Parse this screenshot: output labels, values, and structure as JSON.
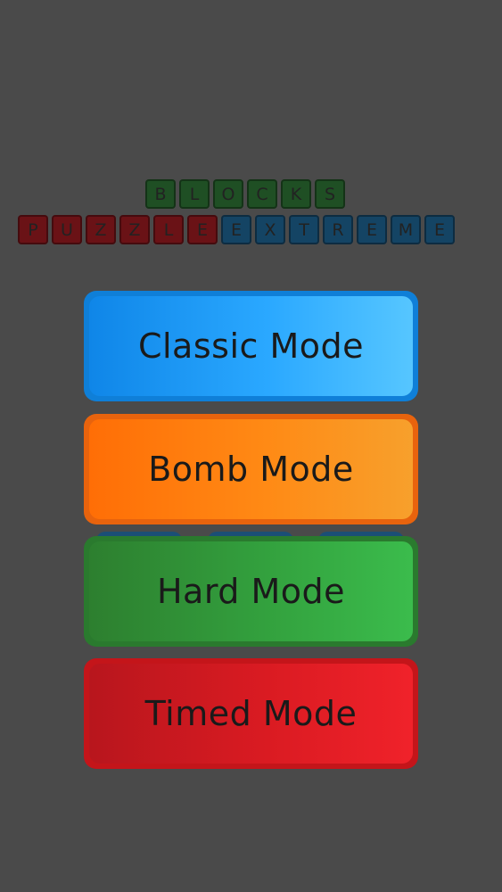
{
  "title": {
    "row1": [
      "B",
      "L",
      "O",
      "C",
      "K",
      "S"
    ],
    "row2_red": [
      "P",
      "U",
      "Z",
      "Z",
      "L",
      "E"
    ],
    "row2_blue": [
      "E",
      "X",
      "T",
      "R",
      "E",
      "M",
      "E"
    ]
  },
  "modes": {
    "classic": "Classic Mode",
    "bomb": "Bomb Mode",
    "hard": "Hard Mode",
    "timed": "Timed Mode"
  },
  "colors": {
    "background": "#4a4a4a",
    "classic": "#1a95f5",
    "bomb": "#ff7a0c",
    "hard": "#35a33c",
    "timed": "#e01c22"
  }
}
